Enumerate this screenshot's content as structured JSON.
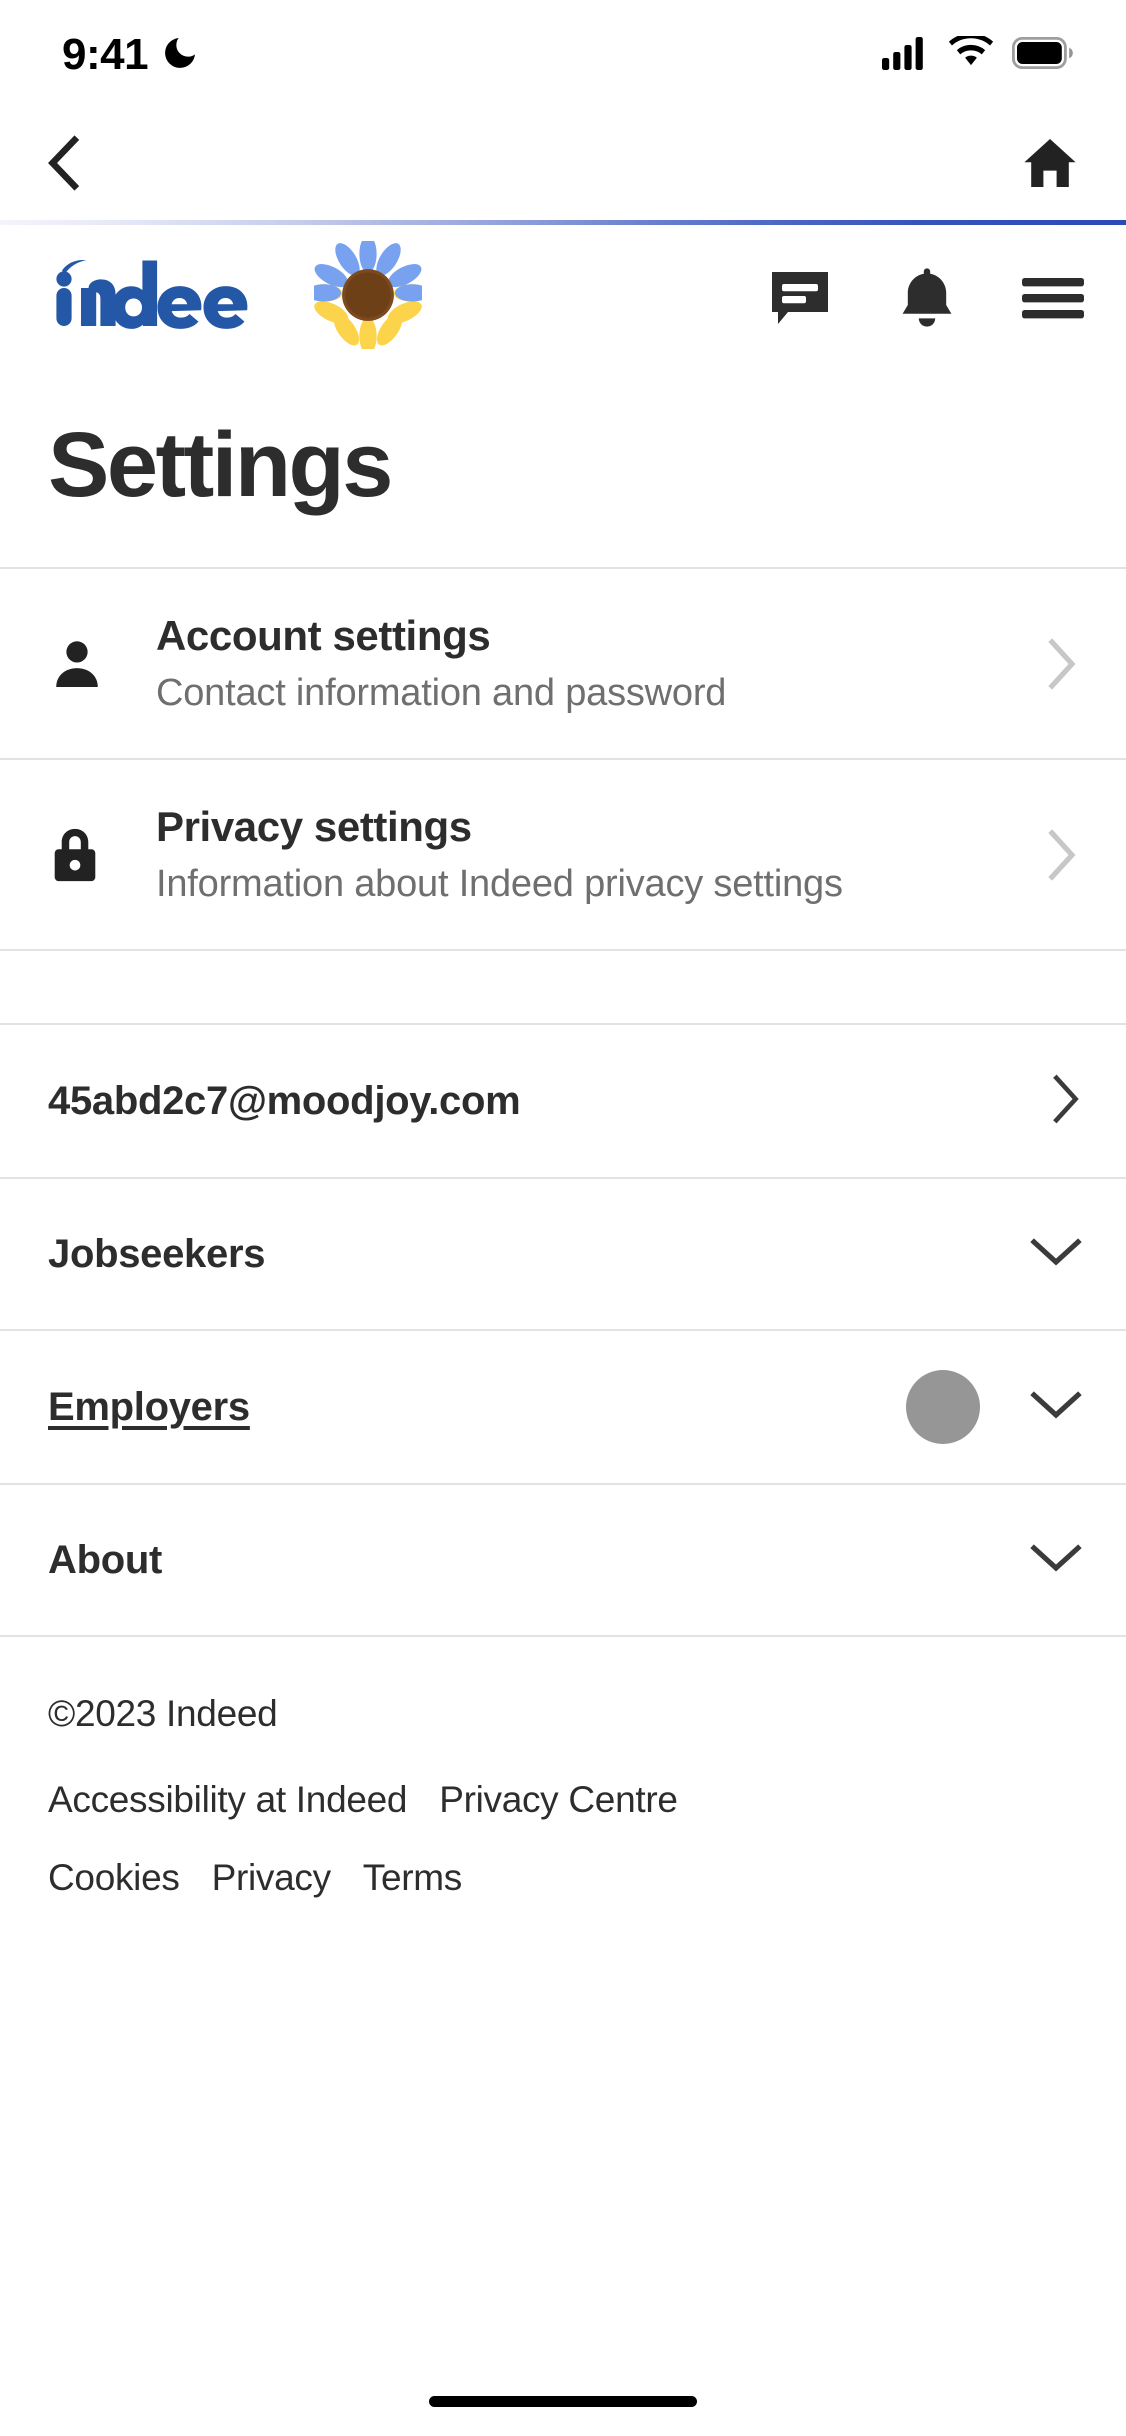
{
  "status_bar": {
    "time": "9:41",
    "dnd_icon": "crescent-moon-icon",
    "signal_icon": "cellular-signal-icon",
    "wifi_icon": "wifi-icon",
    "battery_icon": "battery-full-icon"
  },
  "nav_bar": {
    "back_icon": "chevron-left-icon",
    "home_icon": "home-icon"
  },
  "app_header": {
    "logo_text": "indeed",
    "logo_color": "#2557a7",
    "sunflower_icon": "sunflower-emoji",
    "messages_icon": "message-bubble-icon",
    "notifications_icon": "bell-icon",
    "menu_icon": "hamburger-menu-icon"
  },
  "page": {
    "title": "Settings"
  },
  "settings_rows": [
    {
      "icon": "person-icon",
      "title": "Account settings",
      "subtitle": "Contact information and password",
      "chevron": "chevron-right-icon"
    },
    {
      "icon": "lock-icon",
      "title": "Privacy settings",
      "subtitle": "Information about Indeed privacy settings",
      "chevron": "chevron-right-icon"
    }
  ],
  "link_rows": [
    {
      "label": "45abd2c7@moodjoy.com",
      "chevron": "chevron-right-icon",
      "underlined": false,
      "cursor": false
    },
    {
      "label": "Jobseekers",
      "chevron": "chevron-down-icon",
      "underlined": false,
      "cursor": false
    },
    {
      "label": "Employers",
      "chevron": "chevron-down-icon",
      "underlined": true,
      "cursor": true
    },
    {
      "label": "About",
      "chevron": "chevron-down-icon",
      "underlined": false,
      "cursor": false
    }
  ],
  "footer": {
    "copyright": "©2023 Indeed",
    "links": [
      "Accessibility at Indeed",
      "Privacy Centre",
      "Cookies",
      "Privacy",
      "Terms"
    ]
  },
  "colors": {
    "text_primary": "#2d2d2d",
    "text_secondary": "#6f6f6f",
    "divider": "#e4e2e0",
    "brand_blue": "#2557a7",
    "cursor_gray": "#969696"
  }
}
